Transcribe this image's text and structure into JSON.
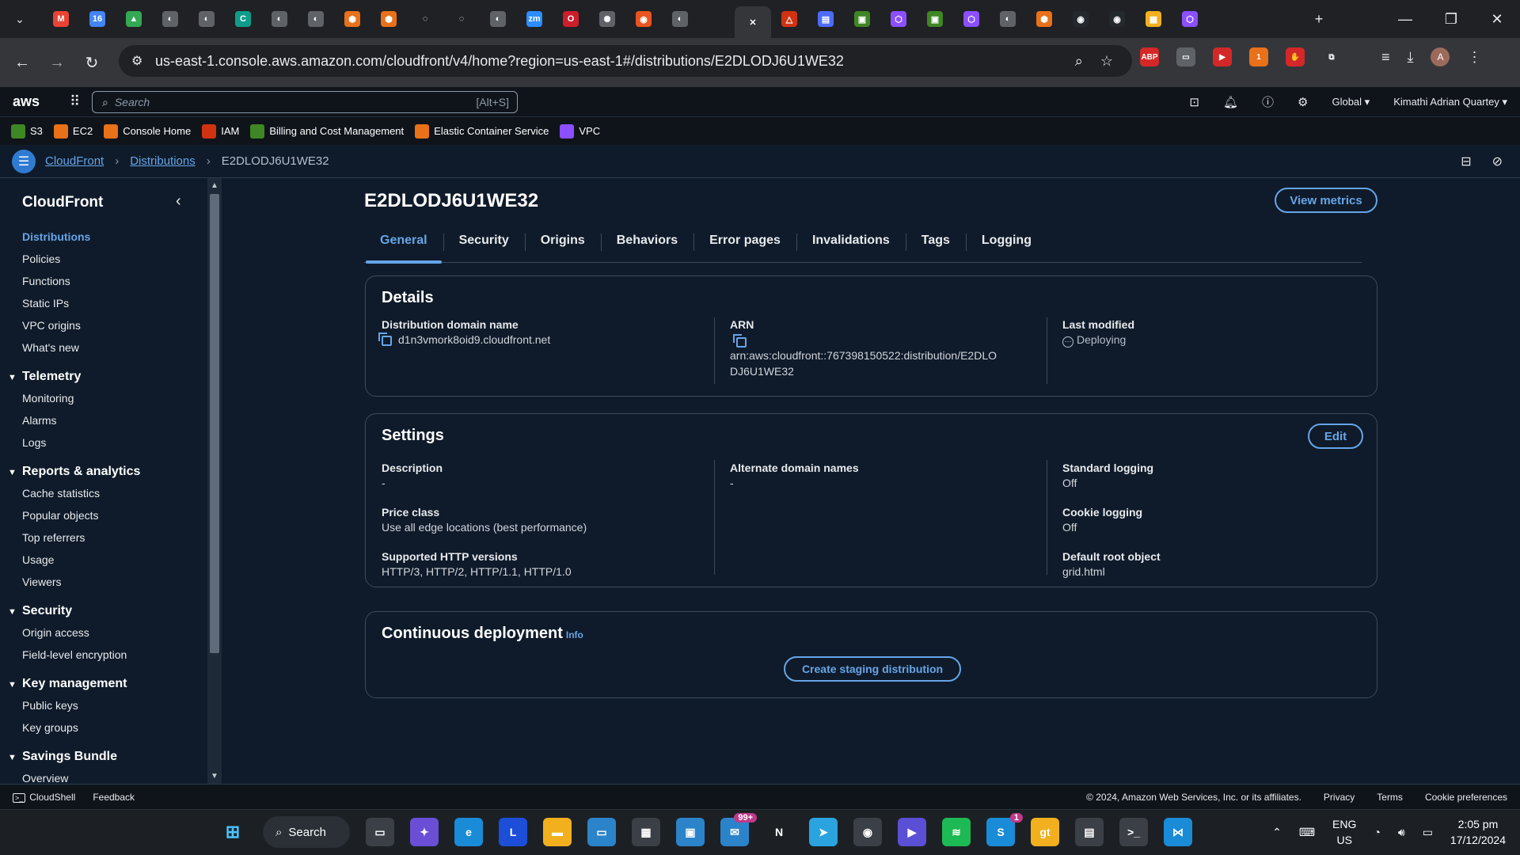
{
  "browser": {
    "url": "us-east-1.console.aws.amazon.com/cloudfront/v4/home?region=us-east-1#/distributions/E2DLODJ6U1WE32",
    "tab_icons": [
      {
        "icon": "gmail-icon",
        "color": "#ea4335",
        "glyph": "M"
      },
      {
        "icon": "calendar-icon",
        "color": "#4285f4",
        "glyph": "16"
      },
      {
        "icon": "drive-icon",
        "color": "#34a853",
        "glyph": "▲"
      },
      {
        "icon": "globe-icon",
        "color": "#5f6368",
        "glyph": "◐"
      },
      {
        "icon": "globe-icon",
        "color": "#5f6368",
        "glyph": "◐"
      },
      {
        "icon": "codeium-icon",
        "color": "#0f9d8a",
        "glyph": "C"
      },
      {
        "icon": "globe-icon",
        "color": "#5f6368",
        "glyph": "◐"
      },
      {
        "icon": "globe-icon",
        "color": "#5f6368",
        "glyph": "◐"
      },
      {
        "icon": "aws-service-icon",
        "color": "#e8711a",
        "glyph": "⬢"
      },
      {
        "icon": "aws-service-icon",
        "color": "#e8711a",
        "glyph": "⬢"
      },
      {
        "icon": "loading-icon",
        "color": "#202124",
        "glyph": "◌"
      },
      {
        "icon": "loading-icon",
        "color": "#202124",
        "glyph": "◌"
      },
      {
        "icon": "globe-icon",
        "color": "#5f6368",
        "glyph": "◐"
      },
      {
        "icon": "zoom-icon",
        "color": "#2d8cff",
        "glyph": "zm"
      },
      {
        "icon": "opera-icon",
        "color": "#cc1e2b",
        "glyph": "O"
      },
      {
        "icon": "chatgpt-icon",
        "color": "#5f6368",
        "glyph": "✺"
      },
      {
        "icon": "ubuntu-icon",
        "color": "#e95420",
        "glyph": "◉"
      },
      {
        "icon": "globe-icon",
        "color": "#5f6368",
        "glyph": "◐"
      },
      {
        "icon": "blank-icon",
        "color": "#202124",
        "glyph": ""
      },
      {
        "icon": "close-icon",
        "color": "#35363a",
        "glyph": "✕",
        "active": true
      },
      {
        "icon": "aws-alarm-icon",
        "color": "#d13212",
        "glyph": "△"
      },
      {
        "icon": "aws-service-icon",
        "color": "#4d6bfe",
        "glyph": "▤"
      },
      {
        "icon": "aws-service-icon",
        "color": "#3f8624",
        "glyph": "▣"
      },
      {
        "icon": "aws-service-icon",
        "color": "#8c4fff",
        "glyph": "⬡"
      },
      {
        "icon": "aws-service-icon",
        "color": "#3f8624",
        "glyph": "▣"
      },
      {
        "icon": "cube-icon",
        "color": "#8c4fff",
        "glyph": "⬡"
      },
      {
        "icon": "globe-icon",
        "color": "#5f6368",
        "glyph": "◐"
      },
      {
        "icon": "aws-service-icon",
        "color": "#e8711a",
        "glyph": "⬢"
      },
      {
        "icon": "github-icon",
        "color": "#24292e",
        "glyph": "◉"
      },
      {
        "icon": "github-icon",
        "color": "#24292e",
        "glyph": "◉"
      },
      {
        "icon": "package-icon",
        "color": "#f2b01e",
        "glyph": "▦"
      },
      {
        "icon": "cube-icon",
        "color": "#8c4fff",
        "glyph": "⬡"
      }
    ],
    "extensions": [
      {
        "icon": "adblock-icon",
        "color": "#d42828",
        "glyph": "ABP"
      },
      {
        "icon": "printer-icon",
        "color": "#5f6368",
        "glyph": "▭"
      },
      {
        "icon": "media-icon",
        "color": "#d42828",
        "glyph": "▶"
      },
      {
        "icon": "extension-badge-icon",
        "color": "#e8711a",
        "glyph": "1"
      },
      {
        "icon": "hand-icon",
        "color": "#d42828",
        "glyph": "✋"
      },
      {
        "icon": "puzzle-icon",
        "color": "#35363a",
        "glyph": "⧉"
      }
    ]
  },
  "aws_nav": {
    "logo": "aws",
    "search_placeholder": "Search",
    "search_shortcut": "[Alt+S]",
    "region": "Global ▾",
    "user": "Kimathi Adrian Quartey ▾"
  },
  "favorites": [
    {
      "label": "S3",
      "color": "#3f8624"
    },
    {
      "label": "EC2",
      "color": "#e8711a"
    },
    {
      "label": "Console Home",
      "color": "#e8711a"
    },
    {
      "label": "IAM",
      "color": "#d13212"
    },
    {
      "label": "Billing and Cost Management",
      "color": "#3f8624"
    },
    {
      "label": "Elastic Container Service",
      "color": "#e8711a"
    },
    {
      "label": "VPC",
      "color": "#8c4fff"
    }
  ],
  "breadcrumb": {
    "items": [
      "CloudFront",
      "Distributions"
    ],
    "current": "E2DLODJ6U1WE32"
  },
  "sidebar": {
    "title": "CloudFront",
    "top_items": [
      "Distributions",
      "Policies",
      "Functions",
      "Static IPs",
      "VPC origins",
      "What's new"
    ],
    "sections": [
      {
        "title": "Telemetry",
        "items": [
          "Monitoring",
          "Alarms",
          "Logs"
        ]
      },
      {
        "title": "Reports & analytics",
        "items": [
          "Cache statistics",
          "Popular objects",
          "Top referrers",
          "Usage",
          "Viewers"
        ]
      },
      {
        "title": "Security",
        "items": [
          "Origin access",
          "Field-level encryption"
        ]
      },
      {
        "title": "Key management",
        "items": [
          "Public keys",
          "Key groups"
        ]
      },
      {
        "title": "Savings Bundle",
        "items": [
          "Overview"
        ]
      }
    ]
  },
  "page": {
    "title": "E2DLODJ6U1WE32",
    "view_metrics": "View metrics",
    "tabs": [
      "General",
      "Security",
      "Origins",
      "Behaviors",
      "Error pages",
      "Invalidations",
      "Tags",
      "Logging"
    ],
    "details": {
      "title": "Details",
      "domain_label": "Distribution domain name",
      "domain_value": "d1n3vmork8oid9.cloudfront.net",
      "arn_label": "ARN",
      "arn_value_line1": "arn:aws:cloudfront::767398150522:distribution/E2DLO",
      "arn_value_line2": "DJ6U1WE32",
      "modified_label": "Last modified",
      "modified_value": "Deploying"
    },
    "settings": {
      "title": "Settings",
      "edit": "Edit",
      "description_label": "Description",
      "description_value": "-",
      "price_label": "Price class",
      "price_value": "Use all edge locations (best performance)",
      "http_label": "Supported HTTP versions",
      "http_value": "HTTP/3, HTTP/2, HTTP/1.1, HTTP/1.0",
      "alt_label": "Alternate domain names",
      "alt_value": "-",
      "std_log_label": "Standard logging",
      "std_log_value": "Off",
      "cookie_label": "Cookie logging",
      "cookie_value": "Off",
      "root_label": "Default root object",
      "root_value": "grid.html"
    },
    "continuous": {
      "title": "Continuous deployment",
      "info": "Info",
      "button": "Create staging distribution"
    }
  },
  "footer": {
    "cloudshell": "CloudShell",
    "feedback": "Feedback",
    "copyright": "© 2024, Amazon Web Services, Inc. or its affiliates.",
    "privacy": "Privacy",
    "terms": "Terms",
    "cookies": "Cookie preferences"
  },
  "taskbar": {
    "search": "Search",
    "apps": [
      {
        "icon": "task-view-icon",
        "color": "#3b3f46",
        "glyph": "▭"
      },
      {
        "icon": "copilot-icon",
        "color": "#6a4fd6",
        "glyph": "✦"
      },
      {
        "icon": "edge-icon",
        "color": "#1a8bd6",
        "glyph": "e"
      },
      {
        "icon": "l-app-icon",
        "color": "#1d4ed8",
        "glyph": "L"
      },
      {
        "icon": "file-explorer-icon",
        "color": "#f2b01e",
        "glyph": "▬"
      },
      {
        "icon": "monitor-icon",
        "color": "#2b84c9",
        "glyph": "▭"
      },
      {
        "icon": "store-icon",
        "color": "#3b3f46",
        "glyph": "▦"
      },
      {
        "icon": "photos-icon",
        "color": "#2b84c9",
        "glyph": "▣"
      },
      {
        "icon": "mail-icon",
        "color": "#2b84c9",
        "glyph": "✉",
        "badge": "99+"
      },
      {
        "icon": "netflix-icon",
        "color": "#1c2025",
        "glyph": "N"
      },
      {
        "icon": "telegram-icon",
        "color": "#2aa3de",
        "glyph": "➤"
      },
      {
        "icon": "chrome-icon",
        "color": "#3b3f46",
        "glyph": "◉"
      },
      {
        "icon": "media-player-icon",
        "color": "#5b4fd6",
        "glyph": "▶"
      },
      {
        "icon": "spotify-icon",
        "color": "#1db954",
        "glyph": "≋"
      },
      {
        "icon": "skype-icon",
        "color": "#1a8bd6",
        "glyph": "S",
        "badge": "1"
      },
      {
        "icon": "git-icon",
        "color": "#f2b01e",
        "glyph": "gt"
      },
      {
        "icon": "notepad-icon",
        "color": "#3b3f46",
        "glyph": "▤"
      },
      {
        "icon": "terminal-icon",
        "color": "#3b3f46",
        "glyph": ">_"
      },
      {
        "icon": "vscode-icon",
        "color": "#1a8bd6",
        "glyph": "⋈"
      }
    ],
    "lang_top": "ENG",
    "lang_bottom": "US",
    "time": "2:05 pm",
    "date": "17/12/2024"
  }
}
